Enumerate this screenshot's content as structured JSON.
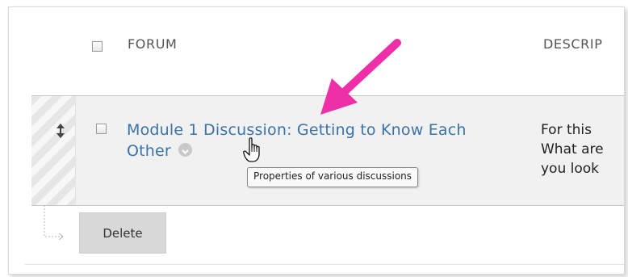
{
  "table": {
    "header": {
      "forum": "FORUM",
      "description": "DESCRIP"
    },
    "rows": [
      {
        "title_line1": "Module 1 Discussion: Getting to Know Each",
        "title_line2": "Other",
        "description_lines": [
          "For this",
          "What are",
          "you look"
        ]
      }
    ]
  },
  "tooltip": "Properties of various discussions",
  "actions": {
    "delete_label": "Delete"
  },
  "icons": [
    "drag-handle-icon",
    "chevron-down-icon",
    "hand-cursor-icon",
    "annotation-arrow",
    "checkbox"
  ],
  "colors": {
    "link": "#3b73a7",
    "annotation_arrow": "#ee2fa7",
    "row_background": "#f1f1f1",
    "button_background": "#d8d8d8"
  }
}
